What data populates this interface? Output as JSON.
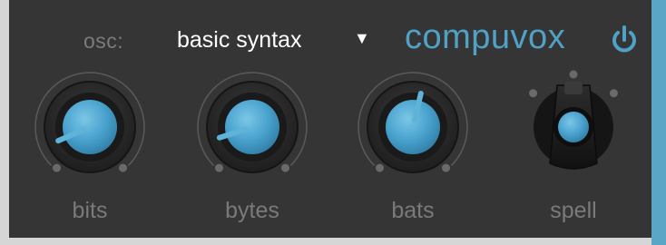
{
  "header": {
    "osc_label": "osc:",
    "preset_value": "basic syntax",
    "preset_arrow": "▼",
    "brand": "compuvox"
  },
  "knobs": [
    {
      "label": "bits",
      "value": 0.08
    },
    {
      "label": "bytes",
      "value": 0.1
    },
    {
      "label": "bats",
      "value": 0.55
    }
  ],
  "switch": {
    "label": "spell",
    "positions": 3,
    "selected": 2
  },
  "colors": {
    "accent": "#5aa6c6",
    "panel": "#353535",
    "knob_cap": "#4aa3cf",
    "label": "#7a7a7a",
    "brand": "#4fa2c6"
  },
  "icons": {
    "power": "power-icon",
    "dropdown": "triangle-down-icon"
  }
}
